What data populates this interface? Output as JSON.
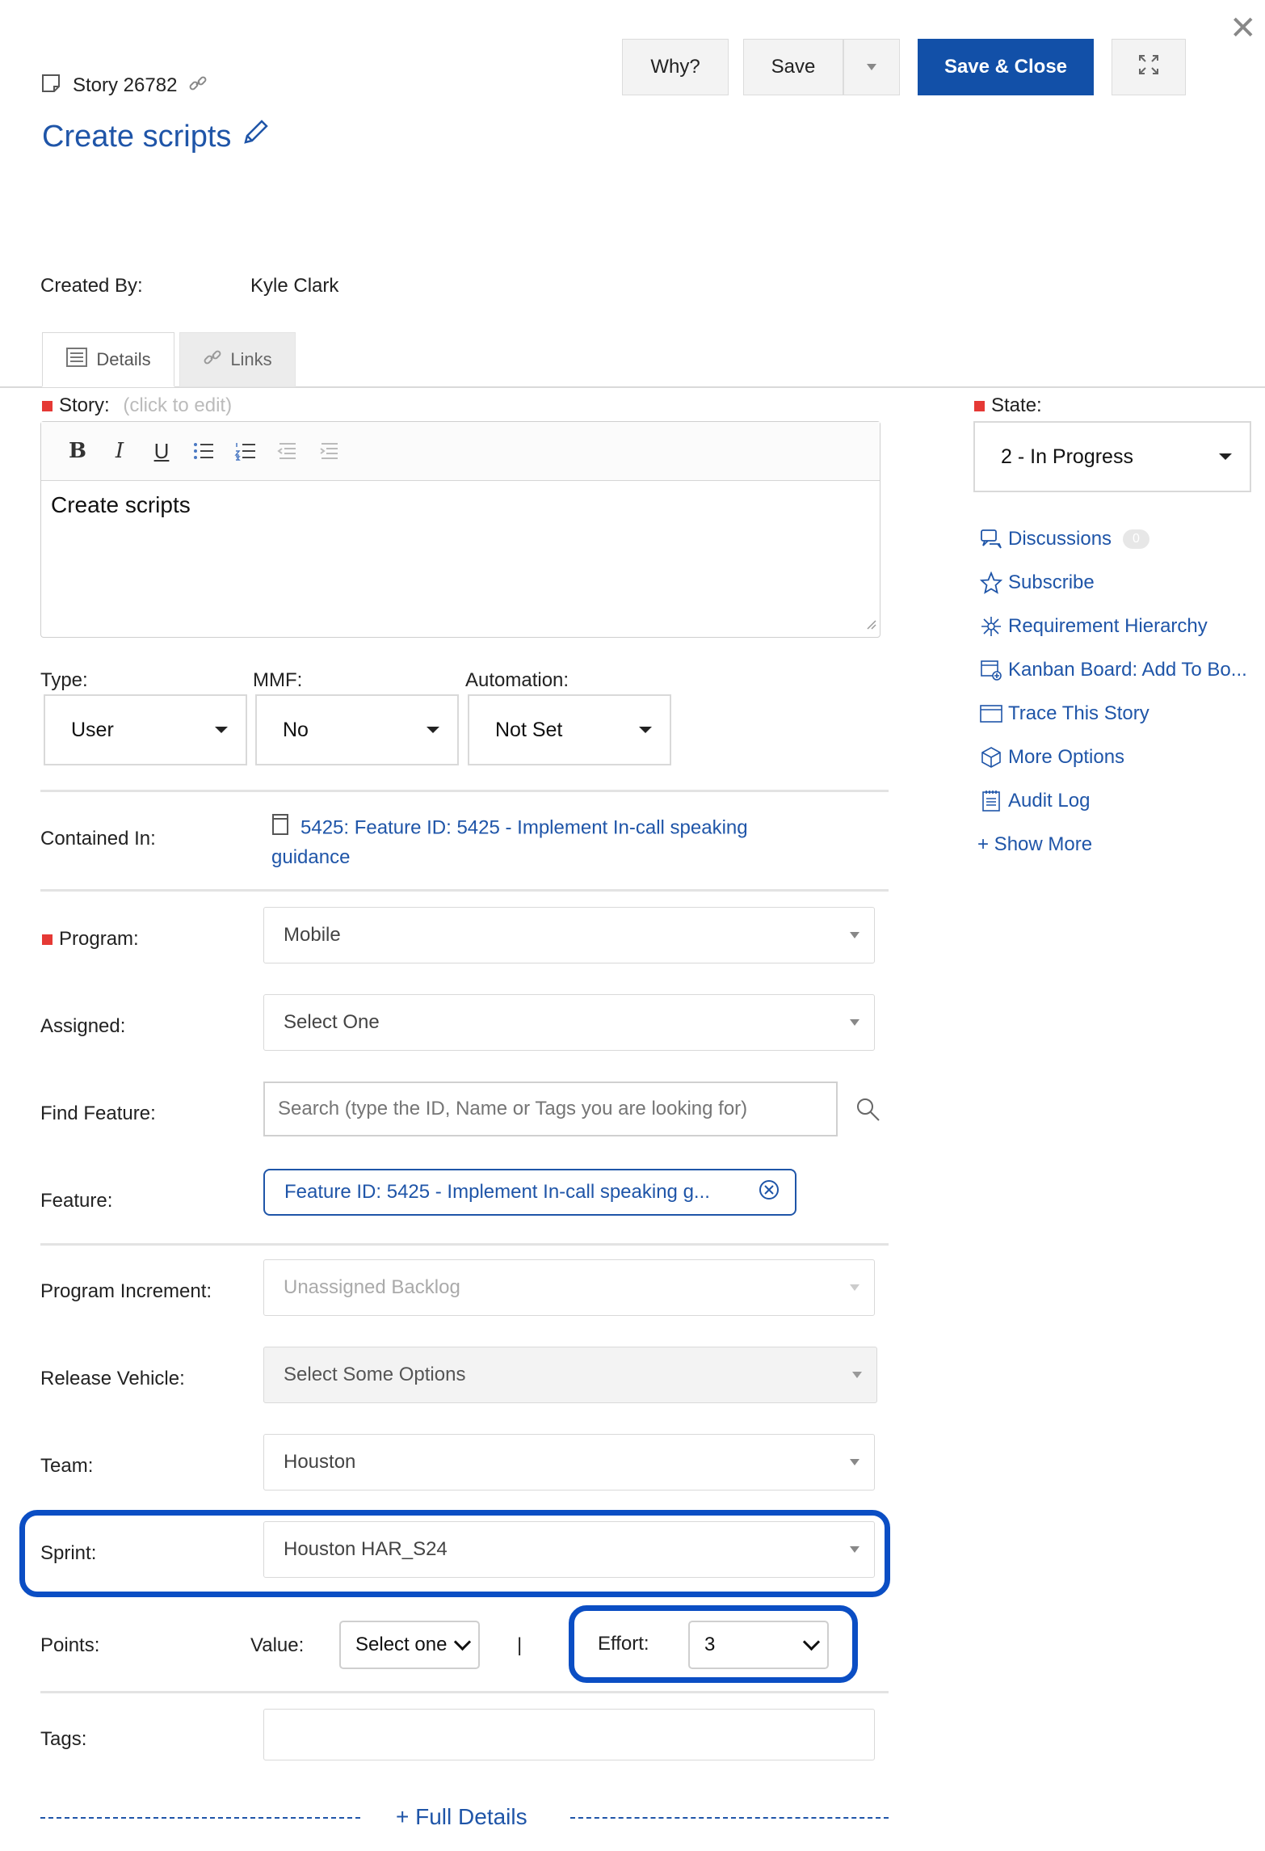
{
  "header": {
    "story_label": "Story 26782",
    "title": "Create scripts",
    "buttons": {
      "why": "Why?",
      "save": "Save",
      "save_close": "Save & Close"
    }
  },
  "meta": {
    "created_by_label": "Created By:",
    "created_by_value": "Kyle Clark"
  },
  "tabs": [
    {
      "label": "Details"
    },
    {
      "label": "Links"
    }
  ],
  "story": {
    "label": "Story:",
    "hint": "(click to edit)",
    "content": "Create scripts"
  },
  "dropdowns": {
    "type": {
      "label": "Type:",
      "value": "User"
    },
    "mmf": {
      "label": "MMF:",
      "value": "No"
    },
    "automation": {
      "label": "Automation:",
      "value": "Not Set"
    }
  },
  "contained_in": {
    "label": "Contained In:",
    "line1": "5425: Feature ID: 5425 - Implement In-call speaking",
    "line2": "guidance"
  },
  "fields": {
    "program": {
      "label": "Program:",
      "value": "Mobile"
    },
    "assigned": {
      "label": "Assigned:",
      "value": "Select One"
    },
    "find_feature": {
      "label": "Find Feature:",
      "placeholder": "Search (type the ID, Name or Tags you are looking for)"
    },
    "feature": {
      "label": "Feature:",
      "value": "Feature ID: 5425 - Implement In-call speaking g..."
    },
    "program_increment": {
      "label": "Program Increment:",
      "value": "Unassigned Backlog"
    },
    "release_vehicle": {
      "label": "Release Vehicle:",
      "value": "Select Some Options"
    },
    "team": {
      "label": "Team:",
      "value": "Houston"
    },
    "sprint": {
      "label": "Sprint:",
      "value": "Houston HAR_S24"
    },
    "points": {
      "label": "Points:",
      "value_label": "Value:",
      "value_selected": "Select one",
      "separator": "|",
      "effort_label": "Effort:",
      "effort_selected": "3"
    },
    "tags": {
      "label": "Tags:",
      "value": ""
    }
  },
  "full_details": "+ Full Details",
  "state": {
    "label": "State:",
    "value": "2 - In Progress"
  },
  "sidebar": {
    "items": [
      {
        "label": "Discussions",
        "icon": "discussion-icon",
        "badge": "0"
      },
      {
        "label": "Subscribe",
        "icon": "star-icon"
      },
      {
        "label": "Requirement Hierarchy",
        "icon": "hierarchy-icon"
      },
      {
        "label": "Kanban Board: Add To Bo...",
        "icon": "kanban-icon"
      },
      {
        "label": "Trace This Story",
        "icon": "trace-icon"
      },
      {
        "label": "More Options",
        "icon": "box-icon"
      },
      {
        "label": "Audit Log",
        "icon": "log-icon"
      }
    ],
    "show_more": "+ Show More"
  },
  "colors": {
    "accent": "#1f55a8",
    "primary_button": "#1250a8",
    "highlight": "#0b4ec4",
    "required": "#e53935"
  }
}
